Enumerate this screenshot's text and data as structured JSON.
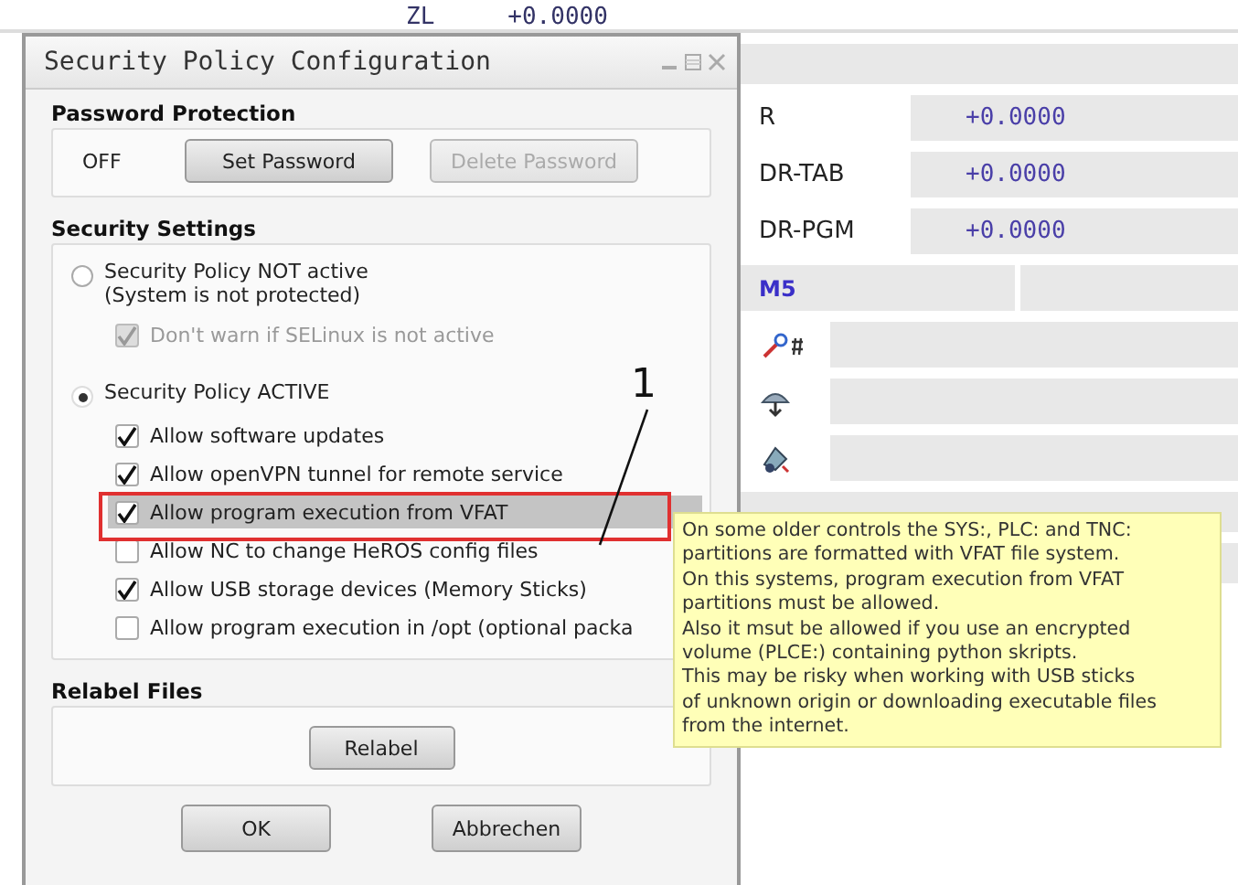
{
  "background_panel": {
    "top_row": {
      "label": "ZL",
      "value": "+0.0000"
    },
    "rows": [
      {
        "kind": "value",
        "label": "R",
        "value": "+0.0000"
      },
      {
        "kind": "value",
        "label": "DR-TAB",
        "value": "+0.0000"
      },
      {
        "kind": "value",
        "label": "DR-PGM",
        "value": "+0.0000"
      },
      {
        "kind": "mcode",
        "label": "M5"
      },
      {
        "kind": "icon"
      },
      {
        "kind": "icon"
      },
      {
        "kind": "icon"
      }
    ]
  },
  "window": {
    "title": "Security Policy Configuration"
  },
  "password_protection": {
    "title": "Password Protection",
    "status": "OFF",
    "buttons": [
      {
        "label": "Set Password",
        "disabled": false
      },
      {
        "label": "Delete Password",
        "disabled": true
      }
    ]
  },
  "security_settings": {
    "title": "Security Settings",
    "options": [
      {
        "label": "Security Policy NOT active\n(System is not protected)",
        "selected": false,
        "children": [
          {
            "label": "Don't warn if SELinux is not active",
            "checked": true,
            "disabled": true,
            "highlighted": false
          }
        ]
      },
      {
        "label": "Security Policy ACTIVE",
        "selected": true,
        "children": [
          {
            "label": "Allow software updates",
            "checked": true,
            "disabled": false,
            "highlighted": false
          },
          {
            "label": "Allow openVPN tunnel for remote service",
            "checked": true,
            "disabled": false,
            "highlighted": false
          },
          {
            "label": "Allow program execution from VFAT",
            "checked": true,
            "disabled": false,
            "highlighted": true
          },
          {
            "label": "Allow NC to change HeROS config files",
            "checked": false,
            "disabled": false,
            "highlighted": false
          },
          {
            "label": "Allow USB storage devices (Memory Sticks)",
            "checked": true,
            "disabled": false,
            "highlighted": false
          },
          {
            "label": "Allow program execution in /opt (optional packa",
            "checked": false,
            "disabled": false,
            "highlighted": false
          }
        ]
      }
    ]
  },
  "relabel_files": {
    "title": "Relabel Files",
    "button": "Relabel"
  },
  "buttons": [
    "OK",
    "Abbrechen"
  ],
  "tooltip": "On some older controls the SYS:, PLC: and TNC:\npartitions are formatted with VFAT file system.\nOn this systems, program execution from VFAT\npartitions must be allowed.\nAlso it msut be allowed if you use an encrypted\nvolume (PLCE:) containing python skripts.\nThis may be risky when working with USB sticks\nof unknown origin or downloading executable files\nfrom the internet.",
  "callout": "1"
}
